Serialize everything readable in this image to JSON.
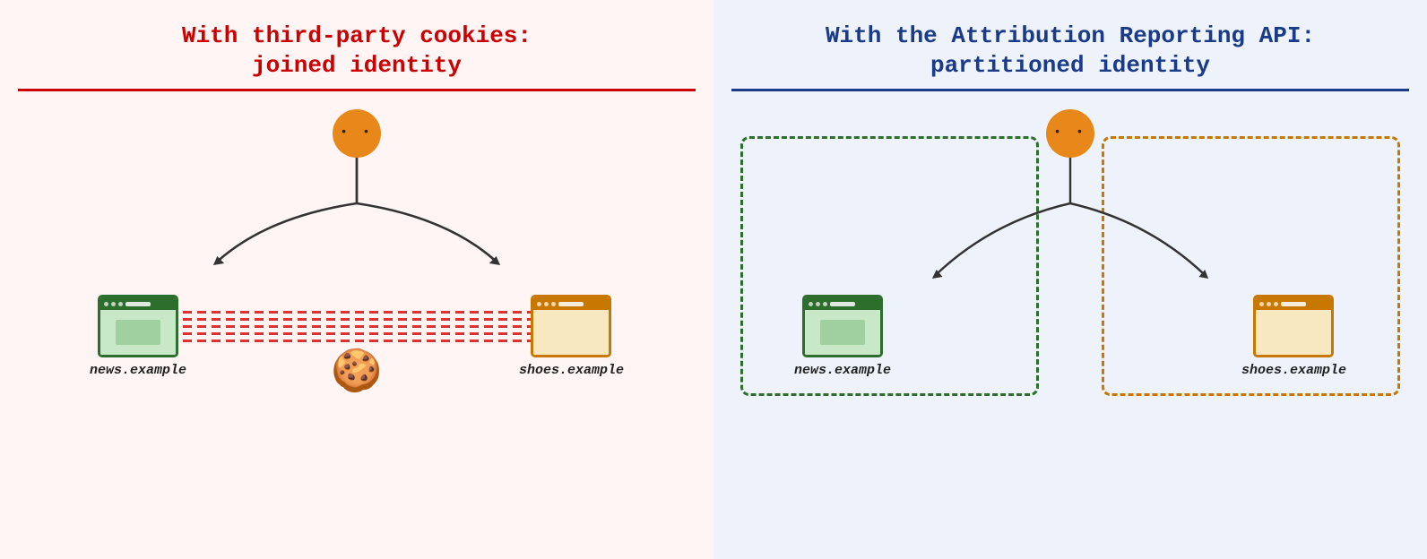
{
  "left": {
    "title_line1": "With third-party cookies:",
    "title_line2": "joined identity",
    "site1": "news.example",
    "site2": "shoes.example"
  },
  "right": {
    "title_line1": "With the Attribution Reporting API:",
    "title_line2": "partitioned identity",
    "site1": "news.example",
    "site2": "shoes.example"
  }
}
